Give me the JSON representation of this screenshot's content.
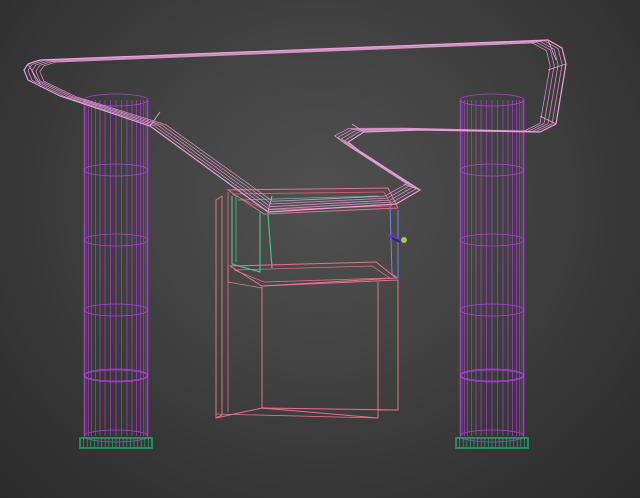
{
  "viewport": {
    "mode": "wireframe",
    "background": "#3a3a3a",
    "objects": [
      {
        "name": "pillar-left",
        "type": "cylinder",
        "wire_color": "#b040d8",
        "base_color": "#22a86a"
      },
      {
        "name": "pillar-right",
        "type": "cylinder",
        "wire_color": "#b040d8",
        "base_color": "#22a86a"
      },
      {
        "name": "overhead-beam",
        "type": "swept-loft",
        "wire_color": "#e8a0d8"
      },
      {
        "name": "suspended-box",
        "type": "box",
        "wire_color": "#e8708a"
      },
      {
        "name": "inner-frame",
        "type": "box",
        "wire_color": "#4dbb8f"
      },
      {
        "name": "pivot-gizmo",
        "type": "gizmo",
        "colors": [
          "#6a30d0",
          "#9ad04a"
        ]
      }
    ]
  }
}
